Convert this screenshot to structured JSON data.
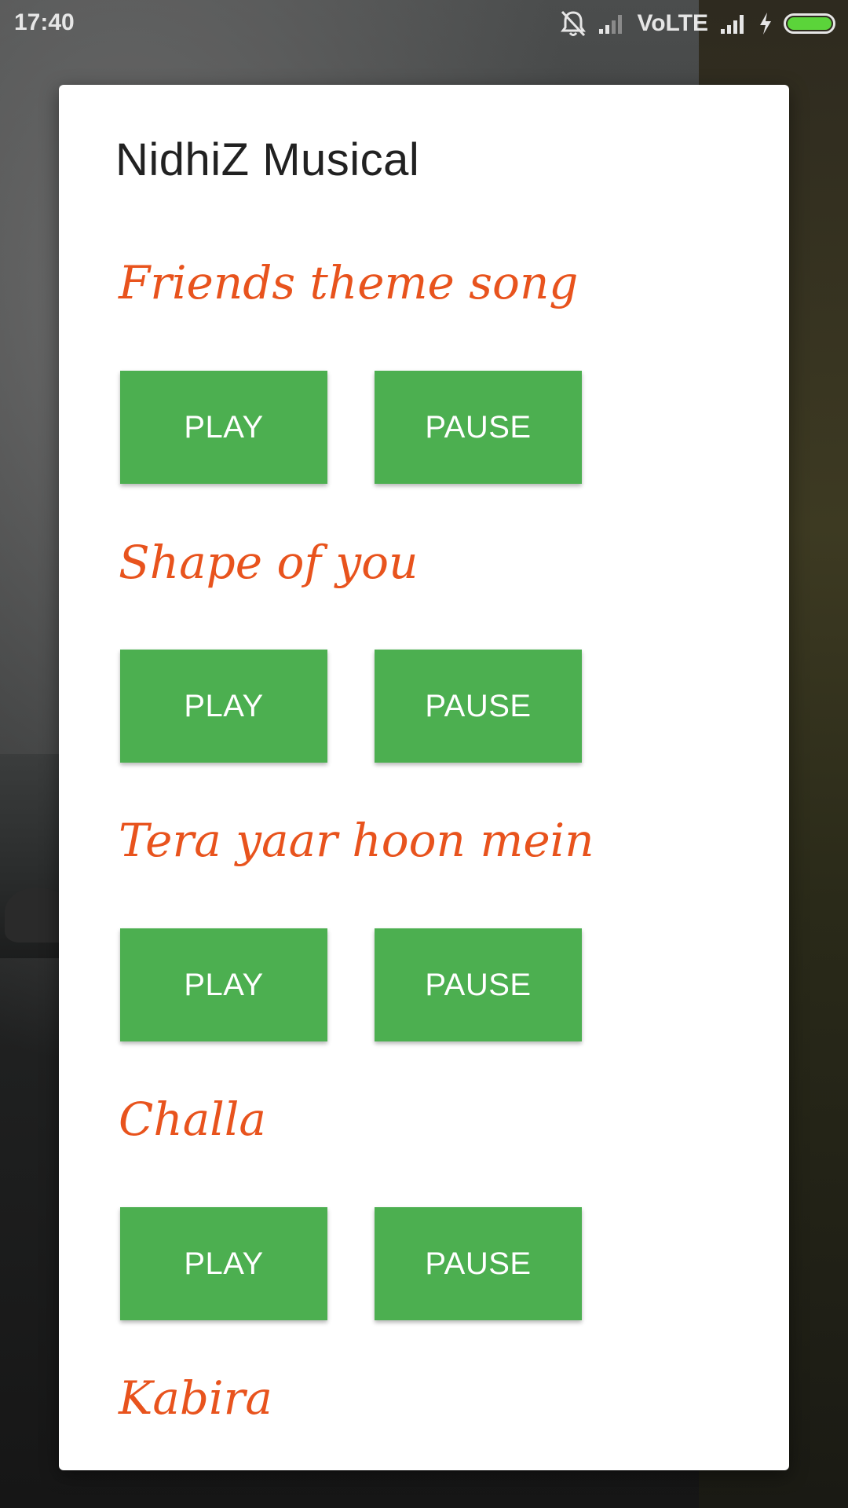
{
  "status_bar": {
    "time": "17:40",
    "network_label": "VoLTE",
    "icons": [
      "bell-muted-icon",
      "signal-icon",
      "signal-icon",
      "charging-bolt-icon",
      "battery-icon"
    ],
    "battery_fill_color": "#5bd43a"
  },
  "dialog": {
    "title": "NidhiZ Musical",
    "songs": [
      {
        "title": "Friends theme song",
        "play_label": "PLAY",
        "pause_label": "PAUSE"
      },
      {
        "title": "Shape of you",
        "play_label": "PLAY",
        "pause_label": "PAUSE"
      },
      {
        "title": "Tera yaar hoon mein",
        "play_label": "PLAY",
        "pause_label": "PAUSE"
      },
      {
        "title": "Challa",
        "play_label": "PLAY",
        "pause_label": "PAUSE"
      },
      {
        "title": "Kabira"
      }
    ]
  },
  "colors": {
    "button_green": "#4caf50",
    "song_title_orange": "#e8531d",
    "dialog_bg": "#ffffff"
  }
}
